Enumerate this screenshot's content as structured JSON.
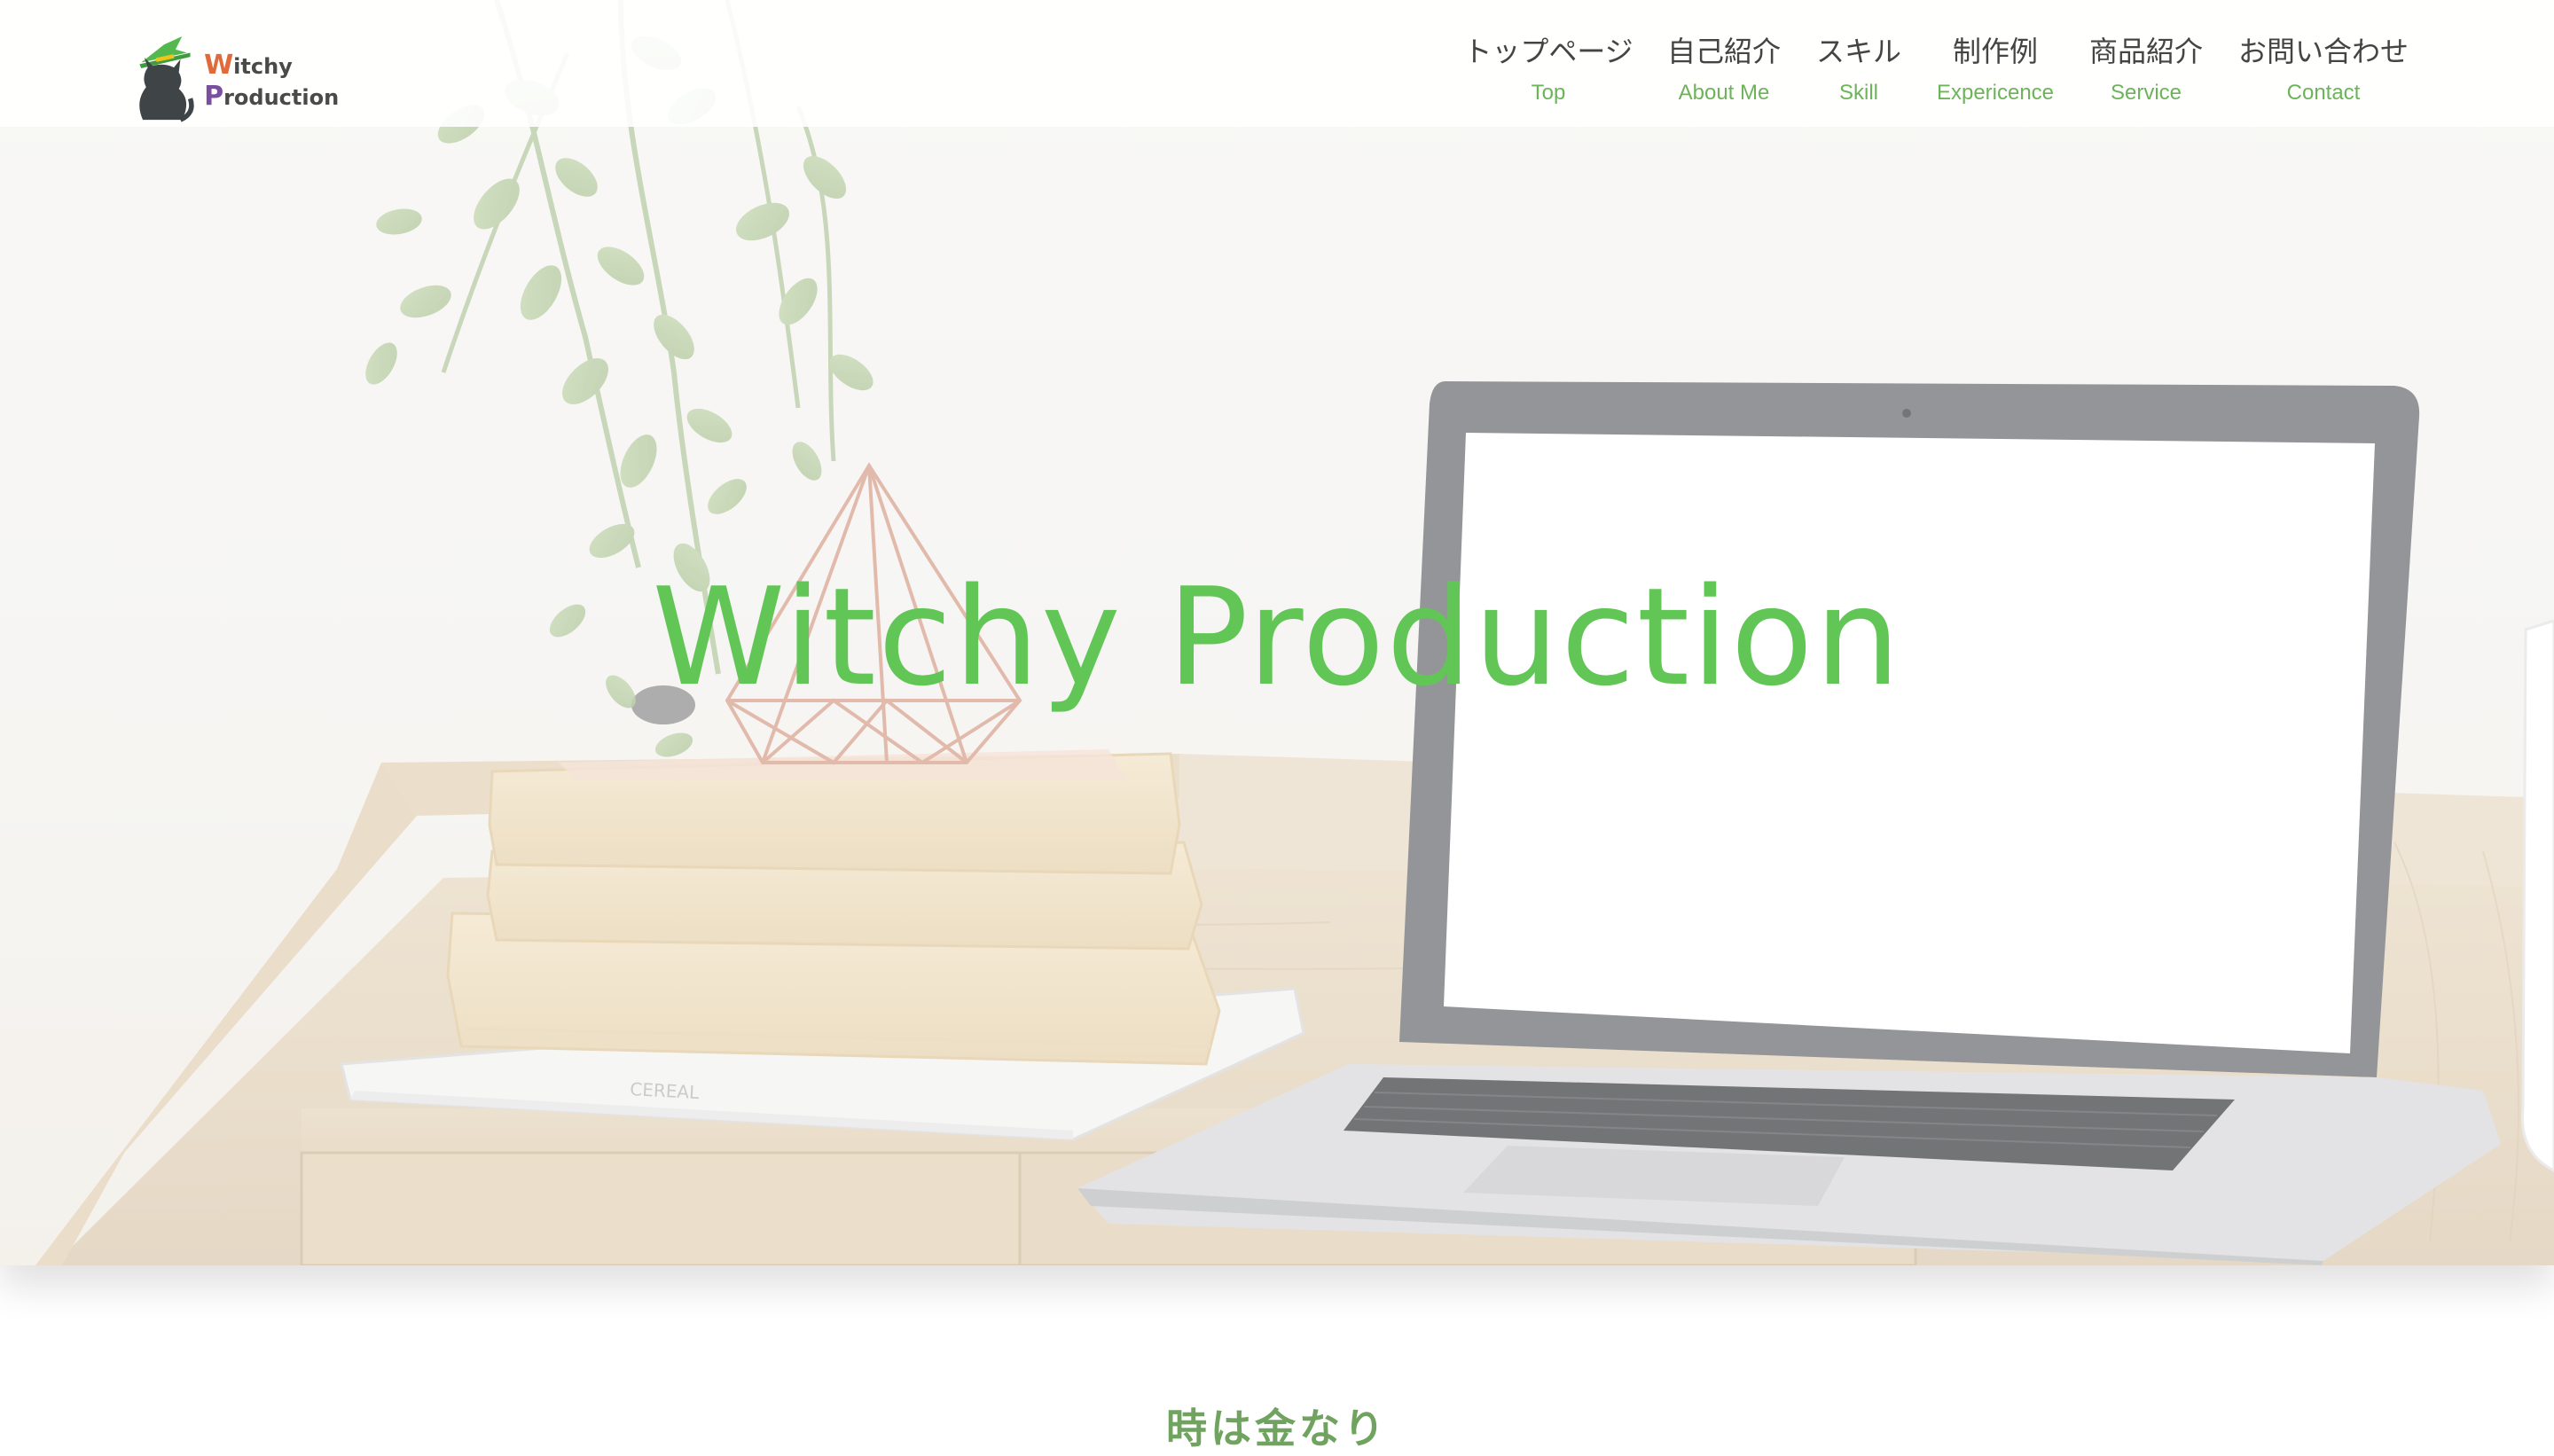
{
  "header": {
    "logo": {
      "text_first": "W",
      "text_mid": "itchy ",
      "text_second": "P",
      "text_last": "roduction"
    },
    "nav": [
      {
        "jp": "トップページ",
        "en": "Top"
      },
      {
        "jp": "自己紹介",
        "en": "About Me"
      },
      {
        "jp": "スキル",
        "en": "Skill"
      },
      {
        "jp": "制作例",
        "en": "Expericence"
      },
      {
        "jp": "商品紹介",
        "en": "Service"
      },
      {
        "jp": "お問い合わせ",
        "en": "Contact"
      }
    ]
  },
  "hero": {
    "title": "Witchy Production",
    "book_spine_text": "CEREAL"
  },
  "section": {
    "heading": "時は金なり"
  },
  "colors": {
    "accent_green": "#62c657",
    "nav_en_green": "#6db35a",
    "heading_green": "#6fa35f",
    "logo_w": "#e06a3b",
    "logo_p": "#7a4fa0"
  }
}
